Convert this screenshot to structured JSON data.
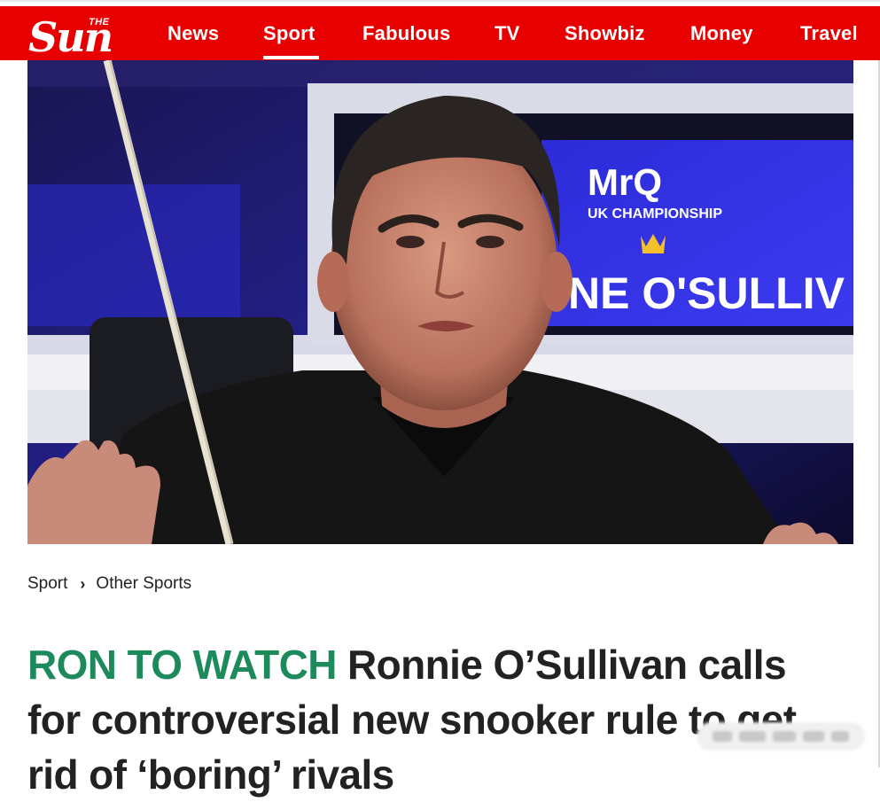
{
  "brand": {
    "logo_small": "THE",
    "logo_main": "Sun",
    "color": "#e80000"
  },
  "nav": {
    "items": [
      {
        "label": "News"
      },
      {
        "label": "Sport",
        "active": true
      },
      {
        "label": "Fabulous"
      },
      {
        "label": "TV"
      },
      {
        "label": "Showbiz"
      },
      {
        "label": "Money"
      },
      {
        "label": "Travel"
      }
    ]
  },
  "hero": {
    "sign_brand": "MrQ",
    "sign_event": "UK CHAMPIONSHIP",
    "sign_name": "NE O'SULLIV"
  },
  "breadcrumb": {
    "section": "Sport",
    "subsection": "Other Sports"
  },
  "article": {
    "kicker": "RON TO WATCH",
    "headline": "Ronnie O’Sullivan calls for controversial new snooker rule to get rid of ‘boring’ rivals",
    "kicker_color": "#1d8a5c"
  }
}
